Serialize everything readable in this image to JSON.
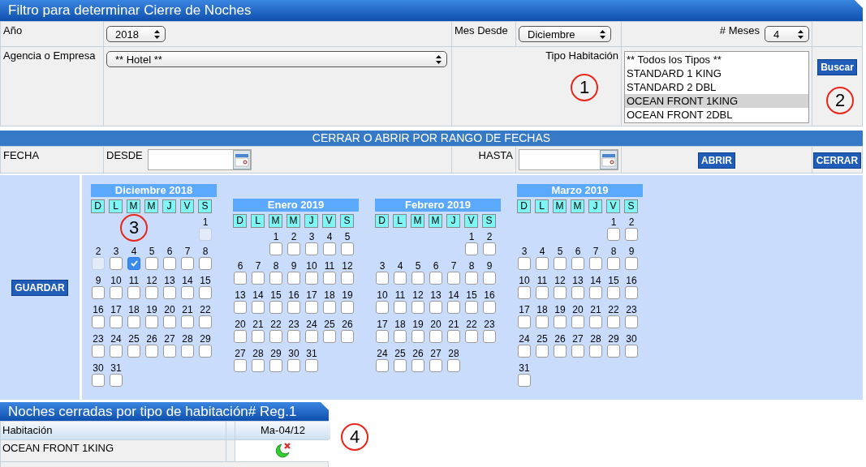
{
  "filter": {
    "title": "Filtro para determinar Cierre de Noches",
    "year": {
      "label": "Año",
      "value": "2018"
    },
    "month_from": {
      "label": "Mes Desde",
      "value": "Diciembre"
    },
    "months_count": {
      "label": "# Meses",
      "value": "4"
    },
    "agency": {
      "label": "Agencia o Empresa",
      "value": "** Hotel **"
    },
    "room_type": {
      "label": "Tipo Habitación",
      "options": [
        {
          "label": "** Todos los Tipos **",
          "selected": false
        },
        {
          "label": "STANDARD 1 KING",
          "selected": false
        },
        {
          "label": "STANDARD 2 DBL",
          "selected": false
        },
        {
          "label": "OCEAN FRONT 1KING",
          "selected": true
        },
        {
          "label": "OCEAN FRONT 2DBL",
          "selected": false
        }
      ]
    },
    "search_button": "Buscar"
  },
  "range": {
    "title": "CERRAR O ABRIR POR RANGO DE FECHAS",
    "date_label": "FECHA",
    "from_label": "DESDE",
    "to_label": "HASTA",
    "open_button": "ABRIR",
    "close_button": "CERRAR"
  },
  "calendar": {
    "save_button": "GUARDAR",
    "months": [
      {
        "title": "Diciembre 2018",
        "weekdays": [
          "D",
          "L",
          "M",
          "M",
          "J",
          "V",
          "S"
        ],
        "days": [
          {
            "kind": "blank"
          },
          {
            "kind": "blank"
          },
          {
            "kind": "blank"
          },
          {
            "kind": "blank"
          },
          {
            "kind": "blank"
          },
          {
            "kind": "blank"
          },
          {
            "kind": "day",
            "label": "1",
            "checked": false,
            "disabled": true
          },
          {
            "kind": "day",
            "label": "2",
            "checked": false,
            "disabled": true
          },
          {
            "kind": "day",
            "label": "3",
            "checked": false,
            "disabled": false
          },
          {
            "kind": "day",
            "label": "4",
            "checked": true,
            "disabled": false
          },
          {
            "kind": "day",
            "label": "5",
            "checked": false,
            "disabled": false
          },
          {
            "kind": "day",
            "label": "6",
            "checked": false,
            "disabled": false
          },
          {
            "kind": "day",
            "label": "7",
            "checked": false,
            "disabled": false
          },
          {
            "kind": "day",
            "label": "8",
            "checked": false,
            "disabled": false
          },
          {
            "kind": "day",
            "label": "9",
            "checked": false,
            "disabled": false
          },
          {
            "kind": "day",
            "label": "10",
            "checked": false,
            "disabled": false
          },
          {
            "kind": "day",
            "label": "11",
            "checked": false,
            "disabled": false
          },
          {
            "kind": "day",
            "label": "12",
            "checked": false,
            "disabled": false
          },
          {
            "kind": "day",
            "label": "13",
            "checked": false,
            "disabled": false
          },
          {
            "kind": "day",
            "label": "14",
            "checked": false,
            "disabled": false
          },
          {
            "kind": "day",
            "label": "15",
            "checked": false,
            "disabled": false
          },
          {
            "kind": "day",
            "label": "16",
            "checked": false,
            "disabled": false
          },
          {
            "kind": "day",
            "label": "17",
            "checked": false,
            "disabled": false
          },
          {
            "kind": "day",
            "label": "18",
            "checked": false,
            "disabled": false
          },
          {
            "kind": "day",
            "label": "19",
            "checked": false,
            "disabled": false
          },
          {
            "kind": "day",
            "label": "20",
            "checked": false,
            "disabled": false
          },
          {
            "kind": "day",
            "label": "21",
            "checked": false,
            "disabled": false
          },
          {
            "kind": "day",
            "label": "22",
            "checked": false,
            "disabled": false
          },
          {
            "kind": "day",
            "label": "23",
            "checked": false,
            "disabled": false
          },
          {
            "kind": "day",
            "label": "24",
            "checked": false,
            "disabled": false
          },
          {
            "kind": "day",
            "label": "25",
            "checked": false,
            "disabled": false
          },
          {
            "kind": "day",
            "label": "26",
            "checked": false,
            "disabled": false
          },
          {
            "kind": "day",
            "label": "27",
            "checked": false,
            "disabled": false
          },
          {
            "kind": "day",
            "label": "28",
            "checked": false,
            "disabled": false
          },
          {
            "kind": "day",
            "label": "29",
            "checked": false,
            "disabled": false
          },
          {
            "kind": "day",
            "label": "30",
            "checked": false,
            "disabled": false
          },
          {
            "kind": "day",
            "label": "31",
            "checked": false,
            "disabled": false
          }
        ]
      },
      {
        "title": "Enero 2019",
        "weekdays": [
          "D",
          "L",
          "M",
          "M",
          "J",
          "V",
          "S"
        ],
        "days": [
          {
            "kind": "blank"
          },
          {
            "kind": "blank"
          },
          {
            "kind": "day",
            "label": "1",
            "checked": false,
            "disabled": false
          },
          {
            "kind": "day",
            "label": "2",
            "checked": false,
            "disabled": false
          },
          {
            "kind": "day",
            "label": "3",
            "checked": false,
            "disabled": false
          },
          {
            "kind": "day",
            "label": "4",
            "checked": false,
            "disabled": false
          },
          {
            "kind": "day",
            "label": "5",
            "checked": false,
            "disabled": false
          },
          {
            "kind": "day",
            "label": "6",
            "checked": false,
            "disabled": false
          },
          {
            "kind": "day",
            "label": "7",
            "checked": false,
            "disabled": false
          },
          {
            "kind": "day",
            "label": "8",
            "checked": false,
            "disabled": false
          },
          {
            "kind": "day",
            "label": "9",
            "checked": false,
            "disabled": false
          },
          {
            "kind": "day",
            "label": "10",
            "checked": false,
            "disabled": false
          },
          {
            "kind": "day",
            "label": "11",
            "checked": false,
            "disabled": false
          },
          {
            "kind": "day",
            "label": "12",
            "checked": false,
            "disabled": false
          },
          {
            "kind": "day",
            "label": "13",
            "checked": false,
            "disabled": false
          },
          {
            "kind": "day",
            "label": "14",
            "checked": false,
            "disabled": false
          },
          {
            "kind": "day",
            "label": "15",
            "checked": false,
            "disabled": false
          },
          {
            "kind": "day",
            "label": "16",
            "checked": false,
            "disabled": false
          },
          {
            "kind": "day",
            "label": "17",
            "checked": false,
            "disabled": false
          },
          {
            "kind": "day",
            "label": "18",
            "checked": false,
            "disabled": false
          },
          {
            "kind": "day",
            "label": "19",
            "checked": false,
            "disabled": false
          },
          {
            "kind": "day",
            "label": "20",
            "checked": false,
            "disabled": false
          },
          {
            "kind": "day",
            "label": "21",
            "checked": false,
            "disabled": false
          },
          {
            "kind": "day",
            "label": "22",
            "checked": false,
            "disabled": false
          },
          {
            "kind": "day",
            "label": "23",
            "checked": false,
            "disabled": false
          },
          {
            "kind": "day",
            "label": "24",
            "checked": false,
            "disabled": false
          },
          {
            "kind": "day",
            "label": "25",
            "checked": false,
            "disabled": false
          },
          {
            "kind": "day",
            "label": "26",
            "checked": false,
            "disabled": false
          },
          {
            "kind": "day",
            "label": "27",
            "checked": false,
            "disabled": false
          },
          {
            "kind": "day",
            "label": "28",
            "checked": false,
            "disabled": false
          },
          {
            "kind": "day",
            "label": "29",
            "checked": false,
            "disabled": false
          },
          {
            "kind": "day",
            "label": "30",
            "checked": false,
            "disabled": false
          },
          {
            "kind": "day",
            "label": "31",
            "checked": false,
            "disabled": false
          }
        ]
      },
      {
        "title": "Febrero 2019",
        "weekdays": [
          "D",
          "L",
          "M",
          "M",
          "J",
          "V",
          "S"
        ],
        "days": [
          {
            "kind": "blank"
          },
          {
            "kind": "blank"
          },
          {
            "kind": "blank"
          },
          {
            "kind": "blank"
          },
          {
            "kind": "blank"
          },
          {
            "kind": "day",
            "label": "1",
            "checked": false,
            "disabled": false
          },
          {
            "kind": "day",
            "label": "2",
            "checked": false,
            "disabled": false
          },
          {
            "kind": "day",
            "label": "3",
            "checked": false,
            "disabled": false
          },
          {
            "kind": "day",
            "label": "4",
            "checked": false,
            "disabled": false
          },
          {
            "kind": "day",
            "label": "5",
            "checked": false,
            "disabled": false
          },
          {
            "kind": "day",
            "label": "6",
            "checked": false,
            "disabled": false
          },
          {
            "kind": "day",
            "label": "7",
            "checked": false,
            "disabled": false
          },
          {
            "kind": "day",
            "label": "8",
            "checked": false,
            "disabled": false
          },
          {
            "kind": "day",
            "label": "9",
            "checked": false,
            "disabled": false
          },
          {
            "kind": "day",
            "label": "10",
            "checked": false,
            "disabled": false
          },
          {
            "kind": "day",
            "label": "11",
            "checked": false,
            "disabled": false
          },
          {
            "kind": "day",
            "label": "12",
            "checked": false,
            "disabled": false
          },
          {
            "kind": "day",
            "label": "13",
            "checked": false,
            "disabled": false
          },
          {
            "kind": "day",
            "label": "14",
            "checked": false,
            "disabled": false
          },
          {
            "kind": "day",
            "label": "15",
            "checked": false,
            "disabled": false
          },
          {
            "kind": "day",
            "label": "16",
            "checked": false,
            "disabled": false
          },
          {
            "kind": "day",
            "label": "17",
            "checked": false,
            "disabled": false
          },
          {
            "kind": "day",
            "label": "18",
            "checked": false,
            "disabled": false
          },
          {
            "kind": "day",
            "label": "19",
            "checked": false,
            "disabled": false
          },
          {
            "kind": "day",
            "label": "20",
            "checked": false,
            "disabled": false
          },
          {
            "kind": "day",
            "label": "21",
            "checked": false,
            "disabled": false
          },
          {
            "kind": "day",
            "label": "22",
            "checked": false,
            "disabled": false
          },
          {
            "kind": "day",
            "label": "23",
            "checked": false,
            "disabled": false
          },
          {
            "kind": "day",
            "label": "24",
            "checked": false,
            "disabled": false
          },
          {
            "kind": "day",
            "label": "25",
            "checked": false,
            "disabled": false
          },
          {
            "kind": "day",
            "label": "26",
            "checked": false,
            "disabled": false
          },
          {
            "kind": "day",
            "label": "27",
            "checked": false,
            "disabled": false
          },
          {
            "kind": "day",
            "label": "28",
            "checked": false,
            "disabled": false
          }
        ]
      },
      {
        "title": "Marzo 2019",
        "weekdays": [
          "D",
          "L",
          "M",
          "M",
          "J",
          "V",
          "S"
        ],
        "days": [
          {
            "kind": "blank"
          },
          {
            "kind": "blank"
          },
          {
            "kind": "blank"
          },
          {
            "kind": "blank"
          },
          {
            "kind": "blank"
          },
          {
            "kind": "day",
            "label": "1",
            "checked": false,
            "disabled": false
          },
          {
            "kind": "day",
            "label": "2",
            "checked": false,
            "disabled": false
          },
          {
            "kind": "day",
            "label": "3",
            "checked": false,
            "disabled": false
          },
          {
            "kind": "day",
            "label": "4",
            "checked": false,
            "disabled": false
          },
          {
            "kind": "day",
            "label": "5",
            "checked": false,
            "disabled": false
          },
          {
            "kind": "day",
            "label": "6",
            "checked": false,
            "disabled": false
          },
          {
            "kind": "day",
            "label": "7",
            "checked": false,
            "disabled": false
          },
          {
            "kind": "day",
            "label": "8",
            "checked": false,
            "disabled": false
          },
          {
            "kind": "day",
            "label": "9",
            "checked": false,
            "disabled": false
          },
          {
            "kind": "day",
            "label": "10",
            "checked": false,
            "disabled": false
          },
          {
            "kind": "day",
            "label": "11",
            "checked": false,
            "disabled": false
          },
          {
            "kind": "day",
            "label": "12",
            "checked": false,
            "disabled": false
          },
          {
            "kind": "day",
            "label": "13",
            "checked": false,
            "disabled": false
          },
          {
            "kind": "day",
            "label": "14",
            "checked": false,
            "disabled": false
          },
          {
            "kind": "day",
            "label": "15",
            "checked": false,
            "disabled": false
          },
          {
            "kind": "day",
            "label": "16",
            "checked": false,
            "disabled": false
          },
          {
            "kind": "day",
            "label": "17",
            "checked": false,
            "disabled": false
          },
          {
            "kind": "day",
            "label": "18",
            "checked": false,
            "disabled": false
          },
          {
            "kind": "day",
            "label": "19",
            "checked": false,
            "disabled": false
          },
          {
            "kind": "day",
            "label": "20",
            "checked": false,
            "disabled": false
          },
          {
            "kind": "day",
            "label": "21",
            "checked": false,
            "disabled": false
          },
          {
            "kind": "day",
            "label": "22",
            "checked": false,
            "disabled": false
          },
          {
            "kind": "day",
            "label": "23",
            "checked": false,
            "disabled": false
          },
          {
            "kind": "day",
            "label": "24",
            "checked": false,
            "disabled": false
          },
          {
            "kind": "day",
            "label": "25",
            "checked": false,
            "disabled": false
          },
          {
            "kind": "day",
            "label": "26",
            "checked": false,
            "disabled": false
          },
          {
            "kind": "day",
            "label": "27",
            "checked": false,
            "disabled": false
          },
          {
            "kind": "day",
            "label": "28",
            "checked": false,
            "disabled": false
          },
          {
            "kind": "day",
            "label": "29",
            "checked": false,
            "disabled": false
          },
          {
            "kind": "day",
            "label": "30",
            "checked": false,
            "disabled": false
          },
          {
            "kind": "day",
            "label": "31",
            "checked": false,
            "disabled": false
          }
        ]
      }
    ]
  },
  "results": {
    "title": "Noches cerradas por tipo de habitación# Reg.1",
    "columns": [
      "Habitación",
      "Ma-04/12"
    ],
    "rows": [
      {
        "room": "OCEAN FRONT 1KING",
        "closed": true
      }
    ]
  },
  "annotations": [
    "1",
    "2",
    "3",
    "4"
  ]
}
